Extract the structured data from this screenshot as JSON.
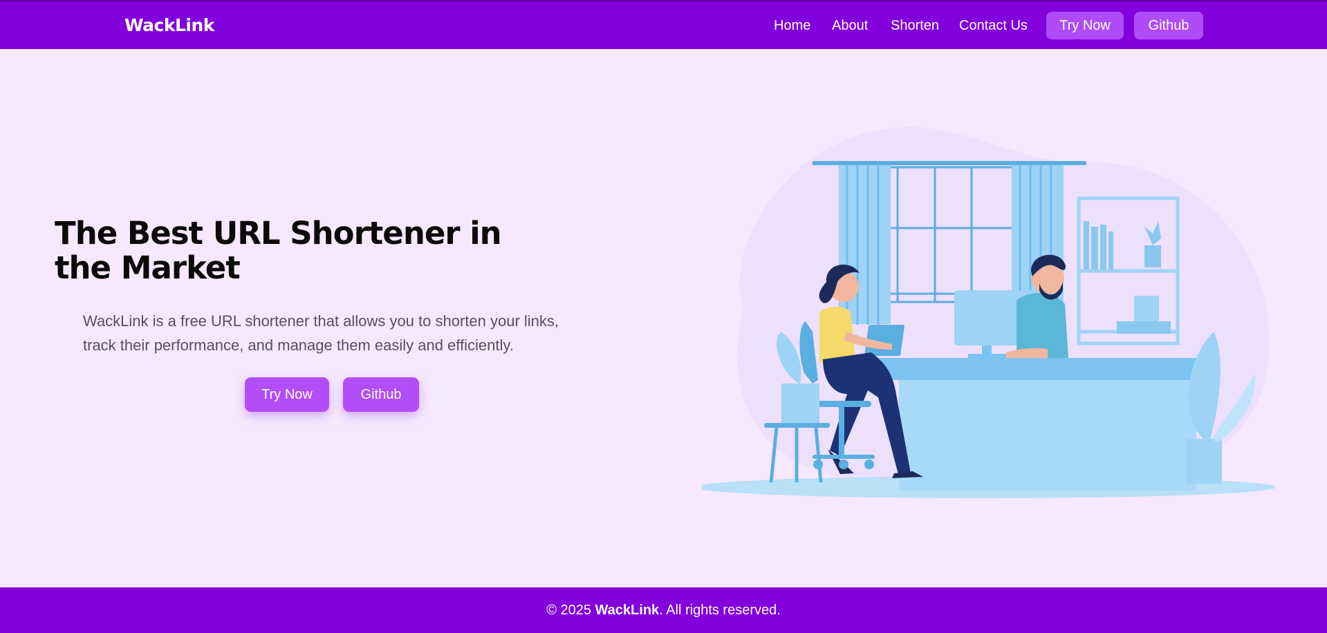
{
  "header": {
    "brand": "WackLink",
    "nav": [
      "Home",
      "About",
      "Shorten",
      "Contact Us"
    ],
    "try_now": "Try Now",
    "github": "Github"
  },
  "hero": {
    "title": "The Best URL Shortener in the Market",
    "description": "WackLink is a free URL shortener that allows you to shorten your links, track their performance, and manage them easily and efficiently.",
    "try_now": "Try Now",
    "github": "Github",
    "illustration": "office-workers-illustration"
  },
  "footer": {
    "copyright_prefix": "© 2025 ",
    "brand": "WackLink",
    "copyright_suffix": ". All rights reserved."
  },
  "colors": {
    "primary": "#8200dc",
    "button": "#b04bf8",
    "background": "#f6e8fe"
  }
}
